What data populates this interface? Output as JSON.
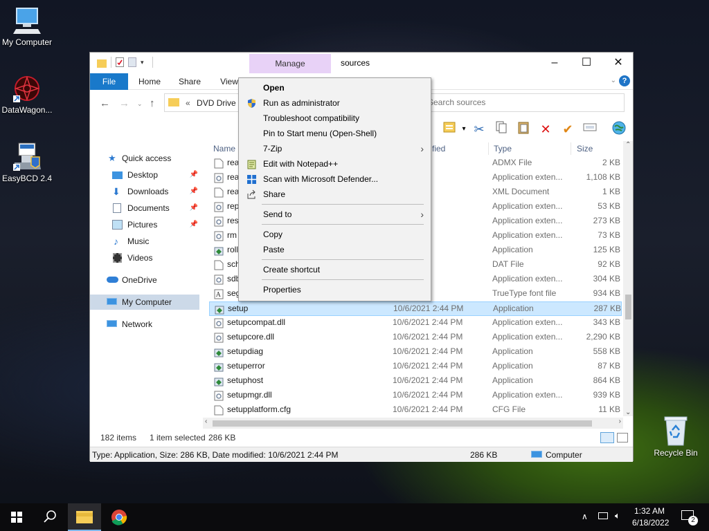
{
  "desktop": {
    "icons": [
      {
        "label": "My Computer"
      },
      {
        "label": "DataWagon..."
      },
      {
        "label": "EasyBCD 2.4"
      }
    ],
    "recycle_bin": "Recycle Bin"
  },
  "explorer": {
    "title": "sources",
    "context_tab": "Manage",
    "ribbon_tabs": [
      "File",
      "Home",
      "Share",
      "View"
    ],
    "address_text": "DVD Drive (E:",
    "search_placeholder": "Search sources",
    "nav": {
      "quick_access": "Quick access",
      "desktop": "Desktop",
      "downloads": "Downloads",
      "documents": "Documents",
      "pictures": "Pictures",
      "music": "Music",
      "videos": "Videos",
      "onedrive": "OneDrive",
      "my_computer": "My Computer",
      "network": "Network"
    },
    "columns": {
      "name": "Name",
      "date": "fied",
      "type": "Type",
      "size": "Size"
    },
    "files": [
      {
        "name": "rea",
        "date": "2:44 PM",
        "type": "ADMX File",
        "size": "2 KB"
      },
      {
        "name": "rea",
        "date": "2:44 PM",
        "type": "Application exten...",
        "size": "1,108 KB"
      },
      {
        "name": "rea",
        "date": "2:44 PM",
        "type": "XML Document",
        "size": "1 KB"
      },
      {
        "name": "rep",
        "date": "2:44 PM",
        "type": "Application exten...",
        "size": "53 KB"
      },
      {
        "name": "res",
        "date": "2:44 PM",
        "type": "Application exten...",
        "size": "273 KB"
      },
      {
        "name": "rm",
        "date": "2:44 PM",
        "type": "Application exten...",
        "size": "73 KB"
      },
      {
        "name": "roll",
        "date": "2:44 PM",
        "type": "Application",
        "size": "125 KB"
      },
      {
        "name": "sch",
        "date": "2:44 PM",
        "type": "DAT File",
        "size": "92 KB"
      },
      {
        "name": "sdb",
        "date": "2:44 PM",
        "type": "Application exten...",
        "size": "304 KB"
      },
      {
        "name": "seg",
        "date": "2:44 PM",
        "type": "TrueType font file",
        "size": "934 KB"
      },
      {
        "name": "setup",
        "date": "10/6/2021 2:44 PM",
        "type": "Application",
        "size": "287 KB",
        "selected": true
      },
      {
        "name": "setupcompat.dll",
        "date": "10/6/2021 2:44 PM",
        "type": "Application exten...",
        "size": "343 KB"
      },
      {
        "name": "setupcore.dll",
        "date": "10/6/2021 2:44 PM",
        "type": "Application exten...",
        "size": "2,290 KB"
      },
      {
        "name": "setupdiag",
        "date": "10/6/2021 2:44 PM",
        "type": "Application",
        "size": "558 KB"
      },
      {
        "name": "setuperror",
        "date": "10/6/2021 2:44 PM",
        "type": "Application",
        "size": "87 KB"
      },
      {
        "name": "setuphost",
        "date": "10/6/2021 2:44 PM",
        "type": "Application",
        "size": "864 KB"
      },
      {
        "name": "setupmgr.dll",
        "date": "10/6/2021 2:44 PM",
        "type": "Application exten...",
        "size": "939 KB"
      },
      {
        "name": "setupplatform.cfg",
        "date": "10/6/2021 2:44 PM",
        "type": "CFG File",
        "size": "11 KB"
      }
    ],
    "status": {
      "count": "182 items",
      "selected": "1 item selected",
      "size": "286 KB"
    },
    "details": {
      "text": "Type: Application, Size: 286 KB, Date modified: 10/6/2021 2:44 PM",
      "size": "286 KB",
      "location": "Computer"
    }
  },
  "context_menu": {
    "items": [
      {
        "label": "Open"
      },
      {
        "label": "Run as administrator"
      },
      {
        "label": "Troubleshoot compatibility"
      },
      {
        "label": "Pin to Start menu (Open-Shell)"
      },
      {
        "label": "7-Zip"
      },
      {
        "label": "Edit with Notepad++"
      },
      {
        "label": "Scan with Microsoft Defender..."
      },
      {
        "label": "Share"
      },
      {
        "label": "Send to"
      },
      {
        "label": "Copy"
      },
      {
        "label": "Paste"
      },
      {
        "label": "Create shortcut"
      },
      {
        "label": "Properties"
      }
    ]
  },
  "taskbar": {
    "time": "1:32 AM",
    "date": "6/18/2022",
    "notification_count": "2"
  },
  "colors": {
    "accent": "#1979ca",
    "selection": "#cce8ff",
    "manage_tab": "#e8d2f7"
  }
}
